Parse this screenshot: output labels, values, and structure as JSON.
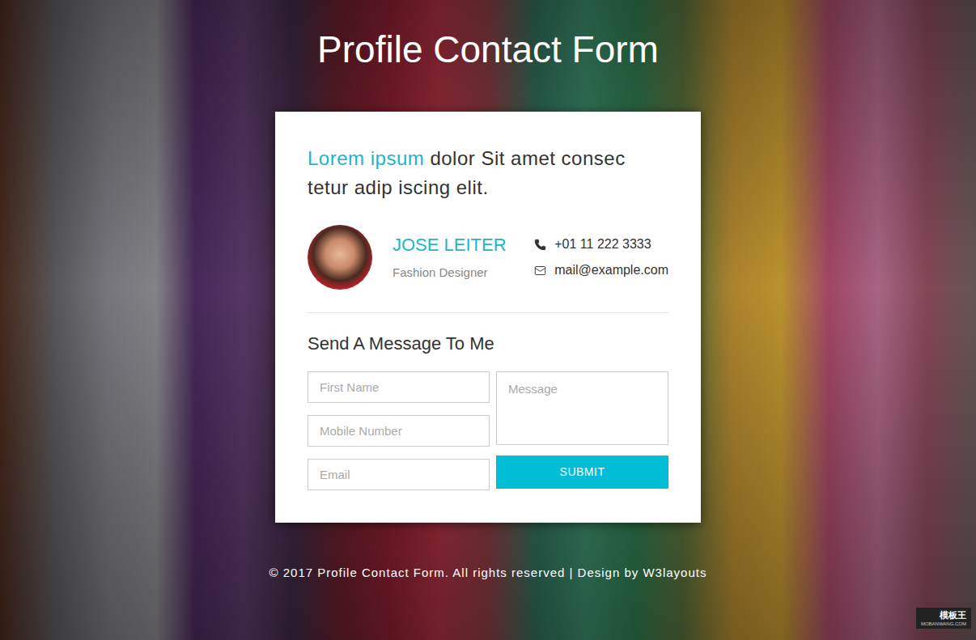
{
  "page": {
    "title": "Profile Contact Form"
  },
  "intro": {
    "highlight": "Lorem ipsum",
    "rest": " dolor Sit amet consec tetur adip iscing elit."
  },
  "profile": {
    "name": "JOSE LEITER",
    "role": "Fashion Designer",
    "contacts": [
      {
        "kind": "phone",
        "text": "+01 11 222 3333"
      },
      {
        "kind": "mail",
        "text": "mail@example.com"
      }
    ]
  },
  "form": {
    "heading": "Send A Message To Me",
    "fields": [
      {
        "placeholder": "First Name"
      },
      {
        "placeholder": "Mobile Number"
      },
      {
        "placeholder": "Email"
      }
    ],
    "message": {
      "placeholder": "Message"
    },
    "submit": "SUBMIT"
  },
  "footer": "© 2017 Profile Contact Form. All rights reserved | Design by W3layouts",
  "watermark": {
    "text": "模板王",
    "url": "MOBANWANG.COM"
  }
}
